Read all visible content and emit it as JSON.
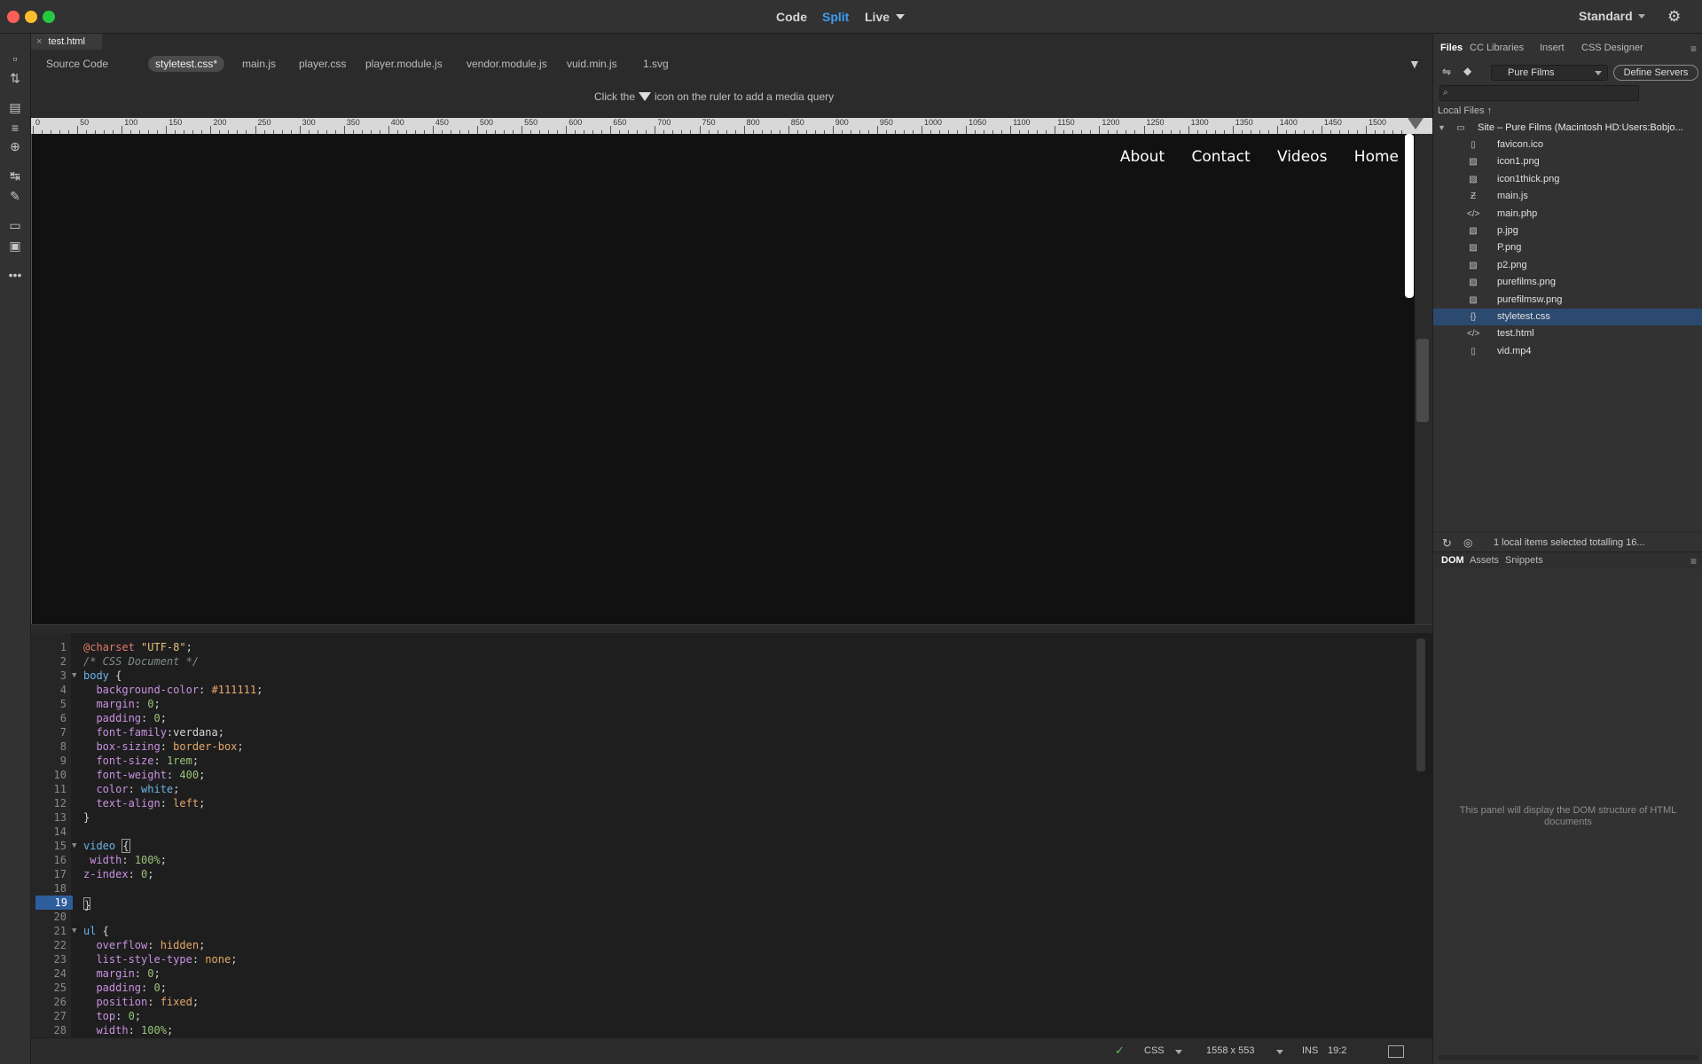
{
  "titlebar": {
    "views": [
      "Code",
      "Split",
      "Live"
    ],
    "workspace": "Standard"
  },
  "document_tab": {
    "close": "×",
    "name": "test.html"
  },
  "related_files": [
    "Source Code",
    "styletest.css*",
    "main.js",
    "player.css",
    "player.module.js",
    "vendor.module.js",
    "vuid.min.js",
    "1.svg"
  ],
  "media_query_hint": {
    "before": "Click the",
    "after": "icon on the ruler to add a media query"
  },
  "ruler_labels": [
    "0",
    "50",
    "100",
    "150",
    "200",
    "250",
    "300",
    "350",
    "400",
    "450",
    "500",
    "550",
    "600",
    "650",
    "700",
    "750",
    "800",
    "850",
    "900",
    "950",
    "1000",
    "1050",
    "1100",
    "1150",
    "1200",
    "1250",
    "1300",
    "1350",
    "1400",
    "1450",
    "1500"
  ],
  "live_view": {
    "nav": [
      "About",
      "Contact",
      "Videos",
      "Home"
    ]
  },
  "code": {
    "lines": [
      {
        "n": "1"
      },
      {
        "n": "2"
      },
      {
        "n": "3"
      },
      {
        "n": "4"
      },
      {
        "n": "5"
      },
      {
        "n": "6"
      },
      {
        "n": "7"
      },
      {
        "n": "8"
      },
      {
        "n": "9"
      },
      {
        "n": "10"
      },
      {
        "n": "11"
      },
      {
        "n": "12"
      },
      {
        "n": "13"
      },
      {
        "n": "14"
      },
      {
        "n": "15"
      },
      {
        "n": "16"
      },
      {
        "n": "17"
      },
      {
        "n": "18"
      },
      {
        "n": "19"
      },
      {
        "n": "20"
      },
      {
        "n": "21"
      },
      {
        "n": "22"
      },
      {
        "n": "23"
      },
      {
        "n": "24"
      },
      {
        "n": "25"
      },
      {
        "n": "26"
      },
      {
        "n": "27"
      },
      {
        "n": "28"
      }
    ],
    "tokens": {
      "l1_at": "@charset",
      "l1_str": "\"UTF-8\"",
      "l1_end": ";",
      "l2": "/* CSS Document */",
      "l3_sel": "body",
      "l3_brace": " {",
      "l4_p": "  background-color",
      "l4_v": "#111111",
      "l5_p": "  margin",
      "l5_v": "0",
      "l6_p": "  padding",
      "l6_v": "0",
      "l7_p": "  font-family",
      "l7_v": "verdana",
      "l8_p": "  box-sizing",
      "l8_v": "border-box",
      "l9_p": "  font-size",
      "l9_v": "1rem",
      "l10_p": "  font-weight",
      "l10_v": "400",
      "l11_p": "  color",
      "l11_v": "white",
      "l12_p": "  text-align",
      "l12_v": "left",
      "l13": "}",
      "l15_sel": "video",
      "l15_brace": "{",
      "l16_p": " width",
      "l16_v": "100%",
      "l17_p": "z-index",
      "l17_v": "0",
      "l19": "}",
      "l21_sel": "ul",
      "l21_brace": " {",
      "l22_p": "  overflow",
      "l22_v": "hidden",
      "l23_p": "  list-style-type",
      "l23_v": "none",
      "l24_p": "  margin",
      "l24_v": "0",
      "l25_p": "  padding",
      "l25_v": "0",
      "l26_p": "  position",
      "l26_v": "fixed",
      "l27_p": "  top",
      "l27_v": "0",
      "l28_p": "  width",
      "l28_v": "100%"
    }
  },
  "statusbar": {
    "language": "CSS",
    "window_size": "1558 x 553",
    "mode": "INS",
    "cursor": "19:2"
  },
  "right_panel": {
    "tabs": [
      "Files",
      "CC Libraries",
      "Insert",
      "CSS Designer"
    ],
    "site": "Pure Films",
    "define_servers": "Define Servers",
    "local_files": "Local Files",
    "site_root": "Site – Pure Films (Macintosh HD:Users:Bobjo...",
    "files": [
      {
        "name": "favicon.ico",
        "icon": "file-icon"
      },
      {
        "name": "icon1.png",
        "icon": "image-icon"
      },
      {
        "name": "icon1thick.png",
        "icon": "image-icon"
      },
      {
        "name": "main.js",
        "icon": "js-icon"
      },
      {
        "name": "main.php",
        "icon": "code-icon"
      },
      {
        "name": "p.jpg",
        "icon": "image-icon"
      },
      {
        "name": "P.png",
        "icon": "image-icon"
      },
      {
        "name": "p2.png",
        "icon": "image-icon"
      },
      {
        "name": "purefilms.png",
        "icon": "image-icon"
      },
      {
        "name": "purefilmsw.png",
        "icon": "image-icon"
      },
      {
        "name": "styletest.css",
        "icon": "css-icon",
        "selected": true
      },
      {
        "name": "test.html",
        "icon": "code-icon"
      },
      {
        "name": "vid.mp4",
        "icon": "file-icon"
      }
    ],
    "footer_status": "1 local items selected totalling 16...",
    "lower_tabs": [
      "DOM",
      "Assets",
      "Snippets"
    ],
    "dom_placeholder": "This panel will display the DOM structure of HTML documents"
  }
}
